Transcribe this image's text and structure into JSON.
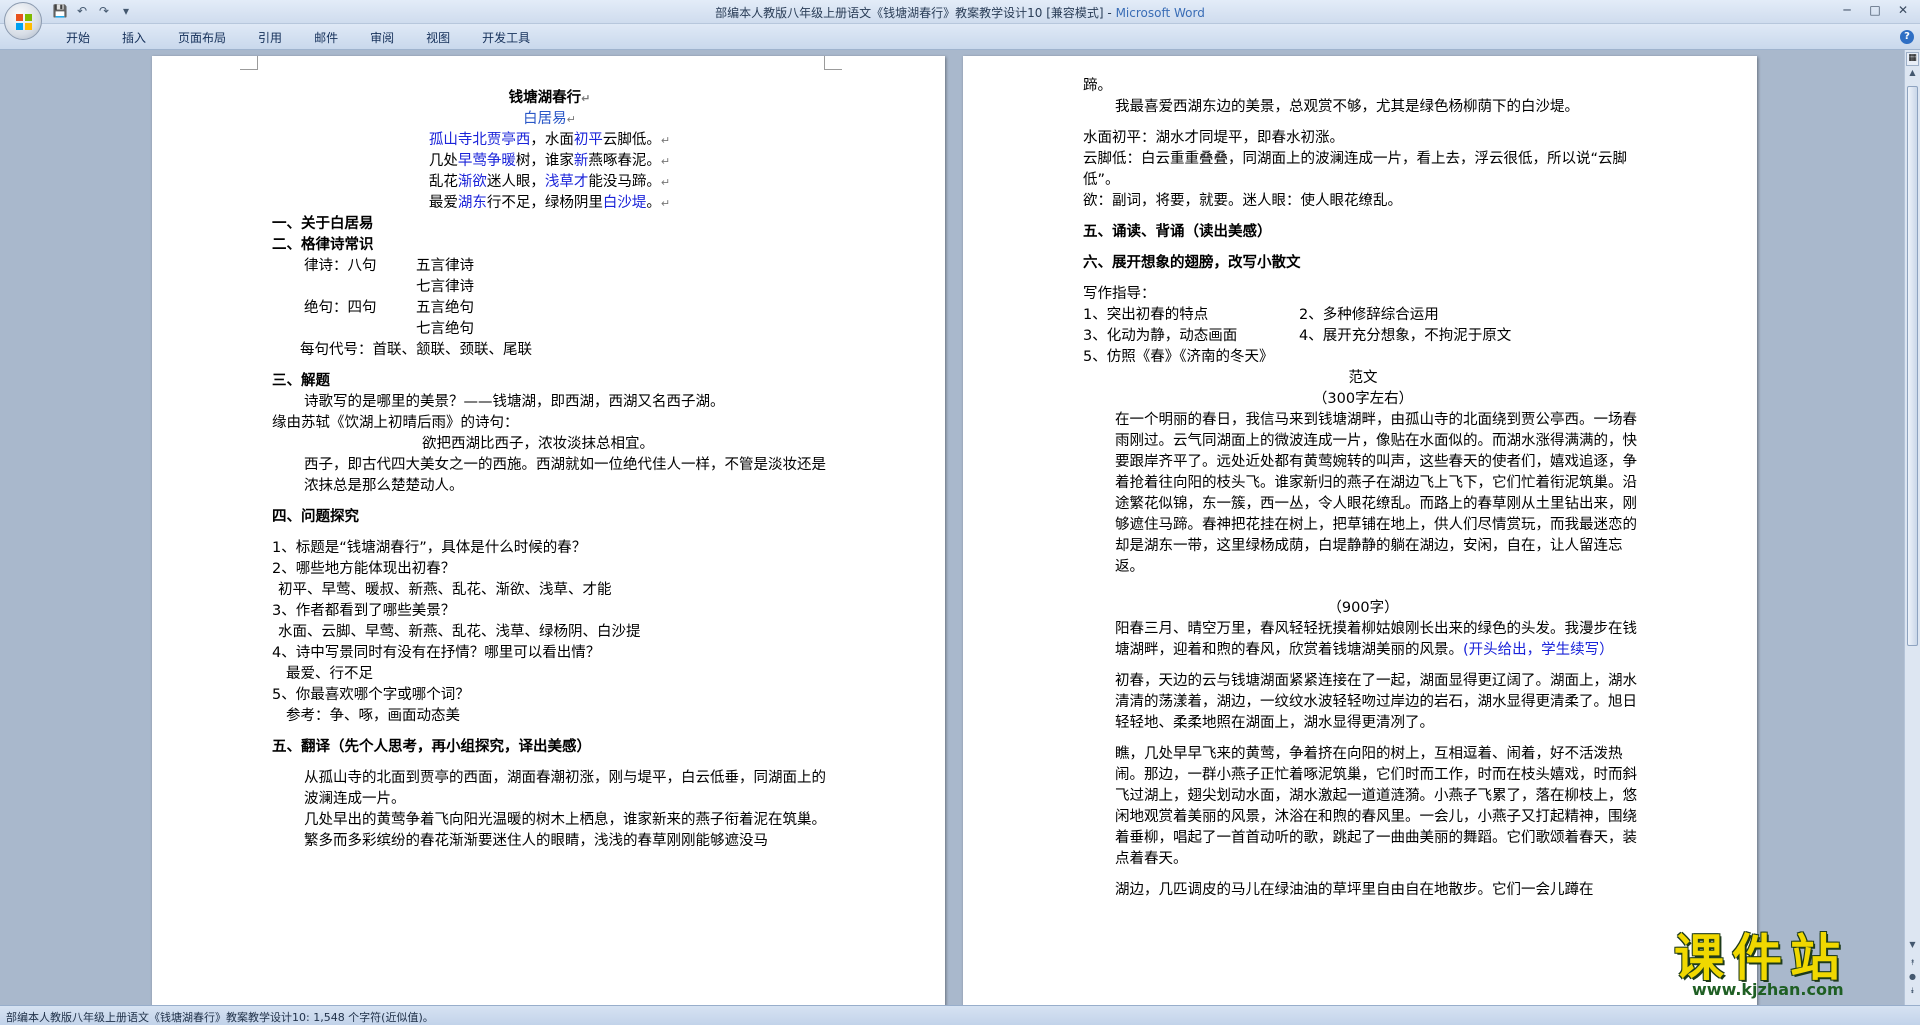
{
  "window": {
    "title": "部编本人教版八年级上册语文《钱塘湖春行》教案教学设计10 [兼容模式]",
    "app": "Microsoft Word"
  },
  "ribbon": {
    "tabs": [
      "开始",
      "插入",
      "页面布局",
      "引用",
      "邮件",
      "审阅",
      "视图",
      "开发工具"
    ]
  },
  "left_page": {
    "title": "钱塘湖春行",
    "author": "白居易",
    "poem": [
      {
        "segs": [
          [
            "b",
            "孤山寺北贾亭西"
          ],
          [
            "n",
            "，水面"
          ],
          [
            "b",
            "初平"
          ],
          [
            "n",
            "云脚低。"
          ]
        ]
      },
      {
        "segs": [
          [
            "n",
            "几处"
          ],
          [
            "b",
            "早莺"
          ],
          [
            "b",
            "争暖"
          ],
          [
            "n",
            "树，谁家"
          ],
          [
            "b",
            "新"
          ],
          [
            "n",
            "燕啄春泥。"
          ]
        ]
      },
      {
        "segs": [
          [
            "n",
            "乱花"
          ],
          [
            "b",
            "渐欲"
          ],
          [
            "n",
            "迷人眼，"
          ],
          [
            "b",
            "浅"
          ],
          [
            "b",
            "草才"
          ],
          [
            "n",
            "能没马蹄。"
          ]
        ]
      },
      {
        "segs": [
          [
            "n",
            "最爱"
          ],
          [
            "b",
            "湖东"
          ],
          [
            "n",
            "行不足，绿杨阴里"
          ],
          [
            "b",
            "白沙堤"
          ],
          [
            "n",
            "。"
          ]
        ]
      }
    ],
    "s1": "一、关于白居易",
    "s2": "二、格律诗常识",
    "lv_a": "律诗：八句",
    "lv_b": "五言律诗",
    "lv_c": "七言律诗",
    "jj_a": "绝句：四句",
    "jj_b": "五言绝句",
    "jj_c": "七言绝句",
    "daihao": "每句代号：首联、颔联、颈联、尾联",
    "s3": "三、解题",
    "jt1": "诗歌写的是哪里的美景？——钱塘湖，即西湖，西湖又名西子湖。",
    "jt2": "缘由苏轼《饮湖上初晴后雨》的诗句：",
    "jt3": "欲把西湖比西子，浓妆淡抹总相宜。",
    "jt4": "西子，即古代四大美女之一的西施。西湖就如一位绝代佳人一样，不管是淡妆还是浓抹总是那么楚楚动人。",
    "s4": "四、问题探究",
    "q1": "1、标题是“钱塘湖春行”，具体是什么时候的春？",
    "q2": "2、哪些地方能体现出初春？",
    "a2": "初平、早莺、暖叔、新燕、乱花、渐欲、浅草、才能",
    "q3": "3、作者都看到了哪些美景？",
    "a3": "水面、云脚、早莺、新燕、乱花、浅草、绿杨阴、白沙提",
    "q4": "4、诗中写景同时有没有在抒情？哪里可以看出情？",
    "a4": "最爱、行不足",
    "q5": "5、你最喜欢哪个字或哪个词？",
    "a5": "参考：争、啄，画面动态美",
    "s5": "五、翻译（先个人思考，再小组探究，译出美感）",
    "fy1": "从孤山寺的北面到贾亭的西面，湖面春潮初涨，刚与堤平，白云低垂，同湖面上的波澜连成一片。",
    "fy2": "几处早出的黄莺争着飞向阳光温暖的树木上栖息，谁家新来的燕子衔着泥在筑巢。",
    "fy3": "繁多而多彩缤纷的春花渐渐要迷住人的眼睛，浅浅的春草刚刚能够遮没马"
  },
  "right_page": {
    "r0": "蹄。",
    "r1": "我最喜爱西湖东边的美景，总观赏不够，尤其是绿色杨柳荫下的白沙堤。",
    "r2": "水面初平：湖水才同堤平，即春水初涨。",
    "r3": "云脚低：白云重重叠叠，同湖面上的波澜连成一片，看上去，浮云很低，所以说“云脚低”。",
    "r4": "欲：副词，将要，就要。迷人眼：使人眼花缭乱。",
    "s5": "五、诵读、背诵（读出美感）",
    "s6": "六、展开想象的翅膀，改写小散文",
    "guide": "写作指导：",
    "g1": "1、突出初春的特点",
    "g2": "2、多种修辞综合运用",
    "g3": "3、化动为静，动态画面",
    "g4": "4、展开充分想象，不拘泥于原文",
    "g5": "5、仿照《春》《济南的冬天》",
    "fw": "范文",
    "fw300": "（300字左右）",
    "essay1": "在一个明丽的春日，我信马来到钱塘湖畔，由孤山寺的北面绕到贾公亭西。一场春雨刚过。云气同湖面上的微波连成一片，像贴在水面似的。而湖水涨得满满的，快要跟岸齐平了。远处近处都有黄莺婉转的叫声，这些春天的使者们，嬉戏追逐，争着抢着往向阳的枝头飞。谁家新归的燕子在湖边飞上飞下，它们忙着衔泥筑巢。沿途繁花似锦，东一簇，西一丛，令人眼花缭乱。而路上的春草刚从土里钻出来，刚够遮住马蹄。春神把花挂在树上，把草铺在地上，供人们尽情赏玩，而我最迷恋的却是湖东一带，这里绿杨成荫，白堤静静的躺在湖边，安闲，自在，让人留连忘返。",
    "fw900": "（900字）",
    "essay2a": "阳春三月、晴空万里，春风轻轻抚摸着柳姑娘刚长出来的绿色的头发。我漫步在钱塘湖畔，迎着和煦的春风，欣赏着钱塘湖美丽的风景。",
    "essay2b": "(开头给出，学生续写）",
    "essay3": "初春，天边的云与钱塘湖面紧紧连接在了一起，湖面显得更辽阔了。湖面上，湖水清清的荡漾着，湖边，一纹纹水波轻轻吻过岸边的岩石，湖水显得更清柔了。旭日轻轻地、柔柔地照在湖面上，湖水显得更清冽了。",
    "essay4": "瞧，几处早早飞来的黄莺，争着挤在向阳的树上，互相逗着、闹着，好不活泼热闹。那边，一群小燕子正忙着啄泥筑巢，它们时而工作，时而在枝头嬉戏，时而斜飞过湖上，翅尖划动水面，湖水激起一道道涟漪。小燕子飞累了，落在柳枝上，悠闲地观赏着美丽的风景，沐浴在和煦的春风里。一会儿，小燕子又打起精神，围绕着垂柳，唱起了一首首动听的歌，跳起了一曲曲美丽的舞蹈。它们歌颂着春天，装点着春天。",
    "essay5": "湖边，几匹调皮的马儿在绿油油的草坪里自由自在地散步。它们一会儿蹲在"
  },
  "statusbar": {
    "text": "部编本人教版八年级上册语文《钱塘湖春行》教案教学设计10: 1,548 个字符(近似值)。"
  },
  "watermark": {
    "cn": "课件站",
    "url": "www.kjzhan.com"
  },
  "colors": {
    "link_blue": "#1a23d9",
    "title_blue": "#2a57c7",
    "watermark_yellow": "#f0d800"
  },
  "paragraph_mark": "↵"
}
